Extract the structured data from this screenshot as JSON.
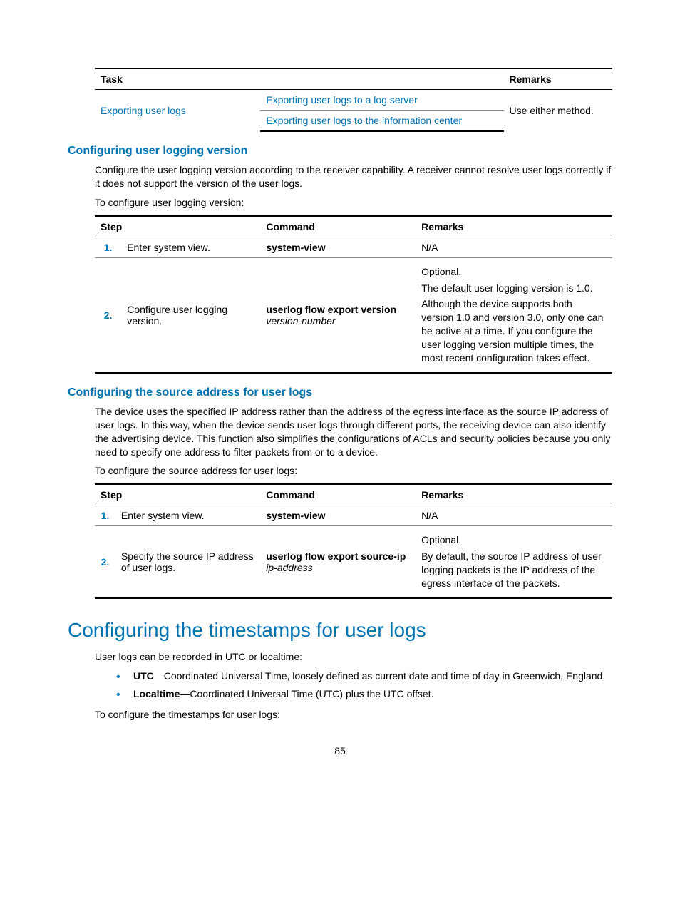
{
  "table_tasks": {
    "headers": {
      "task": "Task",
      "remarks": "Remarks"
    },
    "task_label": "Exporting user logs",
    "sub1": "Exporting user logs to a log server",
    "sub2": "Exporting user logs to the information center",
    "remarks": "Use either method."
  },
  "section1": {
    "title": "Configuring user logging version",
    "p1": "Configure the user logging version according to the receiver capability. A receiver cannot resolve user logs correctly if it does not support the version of the user logs.",
    "p2": "To configure user logging version:",
    "headers": {
      "step": "Step",
      "command": "Command",
      "remarks": "Remarks"
    },
    "row1": {
      "n": "1.",
      "step": "Enter system view.",
      "cmd": "system-view",
      "rem": "N/A"
    },
    "row2": {
      "n": "2.",
      "step": "Configure user logging version.",
      "cmd_b": "userlog flow export version",
      "cmd_i": "version-number",
      "rem1": "Optional.",
      "rem2": "The default user logging version is 1.0.",
      "rem3": "Although the device supports both version 1.0 and version 3.0, only one can be active at a time. If you configure the user logging version multiple times, the most recent configuration takes effect."
    }
  },
  "section2": {
    "title": "Configuring the source address for user logs",
    "p1": "The device uses the specified IP address rather than the address of the egress interface as the source IP address of user logs. In this way, when the device sends user logs through different ports, the receiving device can also identify the advertising device. This function also simplifies the configurations of ACLs and security policies because you only need to specify one address to filter packets from or to a device.",
    "p2": "To configure the source address for user logs:",
    "headers": {
      "step": "Step",
      "command": "Command",
      "remarks": "Remarks"
    },
    "row1": {
      "n": "1.",
      "step": "Enter system view.",
      "cmd": "system-view",
      "rem": "N/A"
    },
    "row2": {
      "n": "2.",
      "step": "Specify the source IP address of user logs.",
      "cmd_b": "userlog flow export source-ip",
      "cmd_i": "ip-address",
      "rem1": "Optional.",
      "rem2": "By default, the source IP address of user logging packets is the IP address of the egress interface of the packets."
    }
  },
  "section3": {
    "title": "Configuring the timestamps for user logs",
    "p1": "User logs can be recorded in UTC or localtime:",
    "b1_b": "UTC",
    "b1_t": "—Coordinated Universal Time, loosely defined as current date and time of day in Greenwich, England.",
    "b2_b": "Localtime",
    "b2_t": "—Coordinated Universal Time (UTC) plus the UTC offset.",
    "p2": "To configure the timestamps for user logs:"
  },
  "page_number": "85"
}
